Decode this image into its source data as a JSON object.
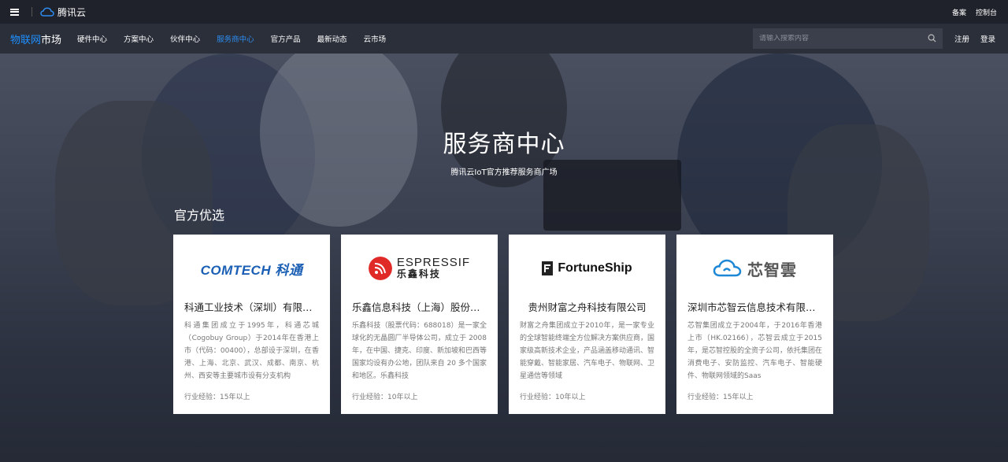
{
  "topbar": {
    "brand": "腾讯云",
    "links": [
      "备案",
      "控制台"
    ]
  },
  "nav": {
    "brand_blue": "物联网",
    "brand_white": "市场",
    "items": [
      {
        "label": "硬件中心",
        "active": false
      },
      {
        "label": "方案中心",
        "active": false
      },
      {
        "label": "伙伴中心",
        "active": false
      },
      {
        "label": "服务商中心",
        "active": true
      },
      {
        "label": "官方产品",
        "active": false
      },
      {
        "label": "最新动态",
        "active": false
      },
      {
        "label": "云市场",
        "active": false
      }
    ],
    "search_placeholder": "请输入搜索内容",
    "register": "注册",
    "login": "登录"
  },
  "hero": {
    "title": "服务商中心",
    "subtitle": "腾讯云IoT官方推荐服务商广场"
  },
  "section": {
    "title": "官方优选"
  },
  "cards": [
    {
      "logo_text": "COMTECH 科通",
      "name": "科通工业技术（深圳）有限公司",
      "desc": "科通集团成立于1995年，科通芯城（Cogobuy Group）于2014年在香港上市（代码：00400），总部设于深圳，在香港、上海、北京、武汉、成都、南京、杭州、西安等主要城市设有分支机构",
      "meta": "行业经验：15年以上"
    },
    {
      "logo_en": "ESPRESSIF",
      "logo_cn": "乐鑫科技",
      "name": "乐鑫信息科技（上海）股份有限公司",
      "desc": "乐鑫科技（股票代码：688018）是一家全球化的无晶圆厂半导体公司，成立于 2008 年，在中国、捷克、印度、新加坡和巴西等国家均设有办公地，团队来自 20 多个国家和地区。乐鑫科技",
      "meta": "行业经验：10年以上"
    },
    {
      "logo_text": "FortuneShip",
      "name": "贵州财富之舟科技有限公司",
      "desc": "财富之舟集团成立于2010年，是一家专业的全球智能终端全方位解决方案供应商，国家级高新技术企业，产品涵盖移动通讯、智能穿戴、智能家居、汽车电子、物联网、卫星通信等领域",
      "meta": "行业经验：10年以上"
    },
    {
      "logo_text": "芯智雲",
      "name": "深圳市芯智云信息技术有限公司",
      "desc": "芯智集团成立于2004年，于2016年香港上市（HK.02166），芯智云成立于2015年，是芯智控股的全资子公司，依托集团在消费电子、安防监控、汽车电子、智能硬件、物联网领域的Saas",
      "meta": "行业经验：15年以上"
    }
  ],
  "colors": {
    "accent": "#2d8cf0",
    "brand_blue": "#1e90ff",
    "topbar_bg": "#1f222a",
    "nav_bg": "#2b2f3a"
  }
}
